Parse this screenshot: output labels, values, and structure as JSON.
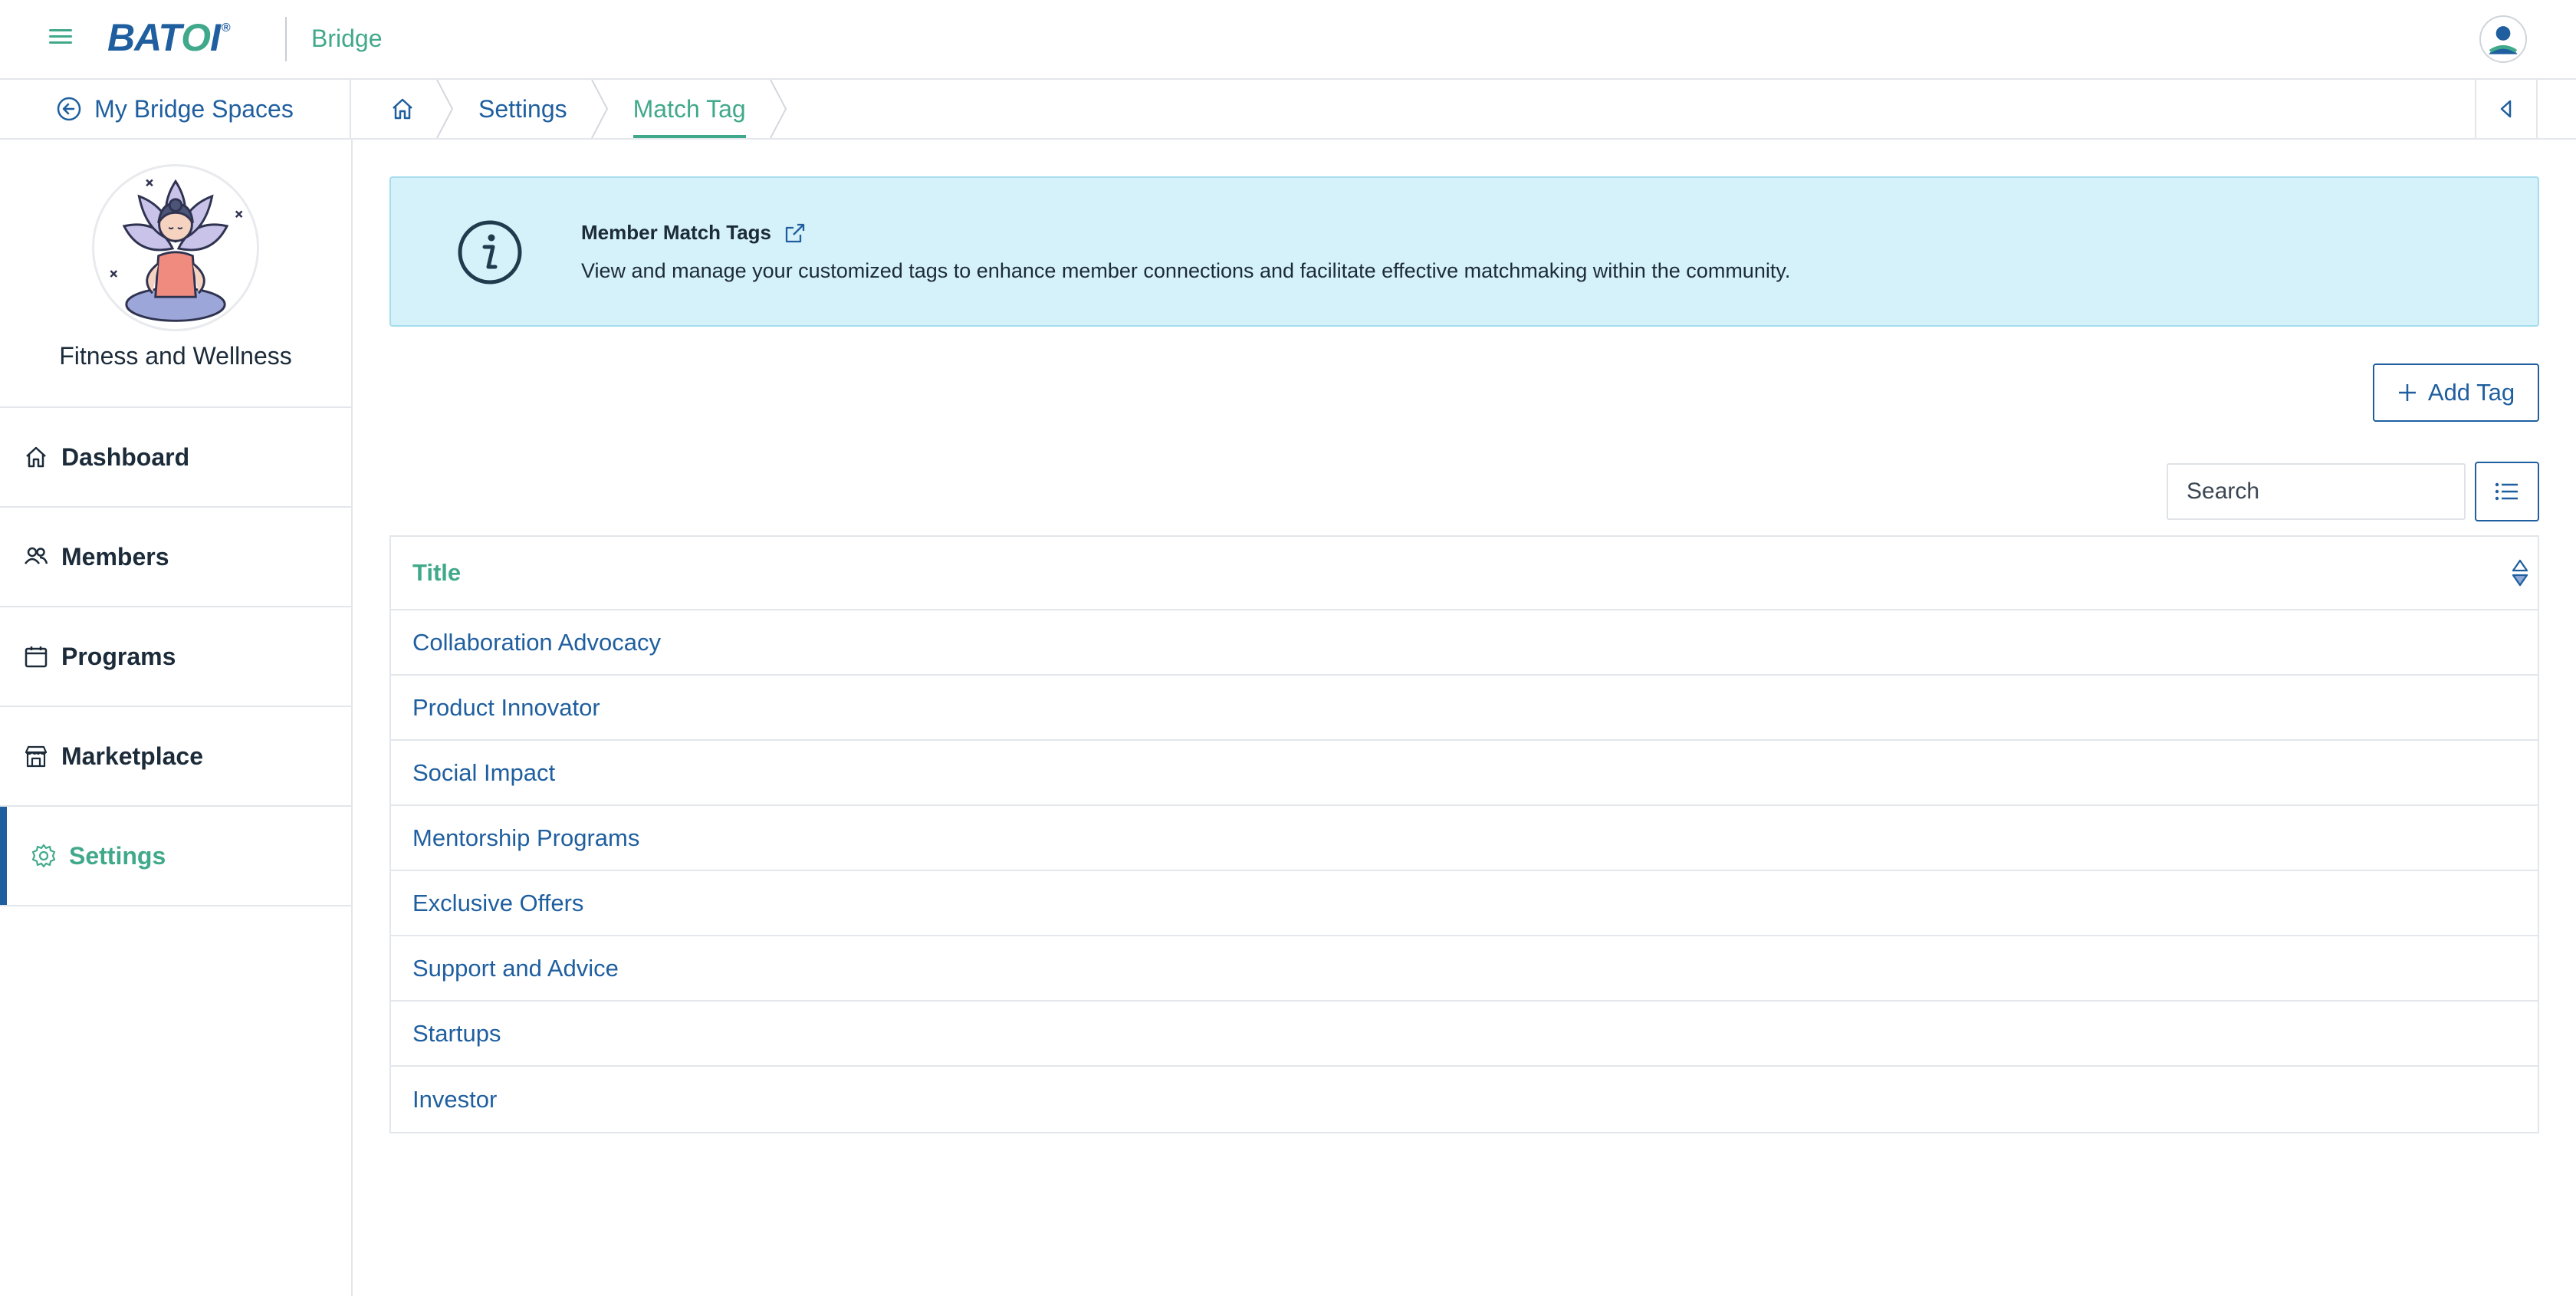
{
  "header": {
    "logo_text_a": "BAT",
    "logo_text_o": "O",
    "logo_text_i": "I",
    "logo_reg": "®",
    "app_name": "Bridge",
    "menu_icon": "hamburger-icon",
    "profile_icon": "user-avatar-icon"
  },
  "breadcrumb": {
    "back_label": "My Bridge Spaces",
    "back_icon": "arrow-left-circle-icon",
    "home_icon": "home-icon",
    "items": [
      {
        "label": "Settings",
        "active": false
      },
      {
        "label": "Match Tag",
        "active": true
      }
    ],
    "collapse_icon": "caret-left-icon"
  },
  "sidebar": {
    "space_name": "Fitness and Wellness",
    "items": [
      {
        "label": "Dashboard",
        "icon": "home-icon",
        "active": false
      },
      {
        "label": "Members",
        "icon": "users-icon",
        "active": false
      },
      {
        "label": "Programs",
        "icon": "calendar-icon",
        "active": false
      },
      {
        "label": "Marketplace",
        "icon": "store-icon",
        "active": false
      },
      {
        "label": "Settings",
        "icon": "gear-icon",
        "active": true
      }
    ]
  },
  "banner": {
    "icon": "info-icon",
    "title": "Member Match Tags",
    "title_link_icon": "external-link-icon",
    "description": "View and manage your customized tags to enhance member connections and facilitate effective matchmaking within the community."
  },
  "toolbar": {
    "add_tag_label": "Add Tag",
    "add_icon": "plus-icon",
    "search_placeholder": "Search",
    "search_value": "",
    "view_toggle_icon": "list-icon"
  },
  "table": {
    "columns": [
      {
        "label": "Title",
        "sortable": true
      }
    ],
    "rows": [
      "Collaboration Advocacy",
      "Product Innovator",
      "Social Impact",
      "Mentorship Programs",
      "Exclusive Offers",
      "Support and Advice",
      "Startups",
      "Investor"
    ]
  },
  "colors": {
    "primary": "#1f5f9f",
    "accent": "#41a98b",
    "banner_bg": "#d5f1f9",
    "border": "#e3e6ea"
  }
}
